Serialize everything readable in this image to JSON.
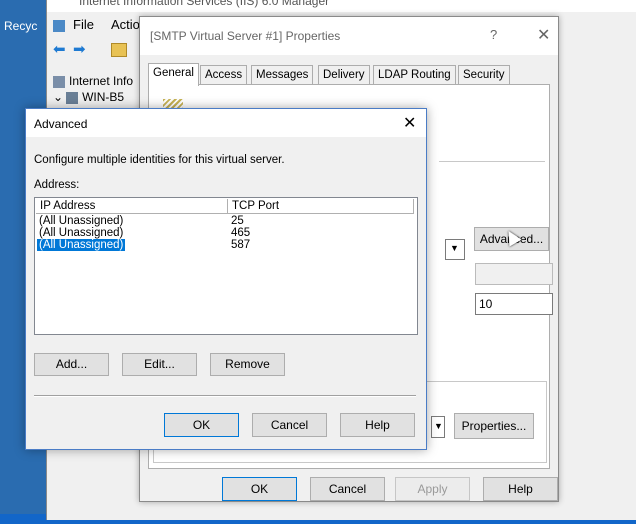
{
  "desktop": {
    "recycle_label": "Recyc"
  },
  "iis": {
    "title": "Internet Information Services (IIS) 6.0 Manager",
    "menu": {
      "file": "File",
      "action": "Actio"
    },
    "tree": {
      "root": "Internet Info",
      "server": "WIN-B5"
    }
  },
  "props": {
    "title": "[SMTP Virtual Server #1] Properties",
    "help_glyph": "?",
    "close_glyph": "✕",
    "tabs": [
      "General",
      "Access",
      "Messages",
      "Delivery",
      "LDAP Routing",
      "Security"
    ],
    "advanced_button": "Advanced...",
    "connections_value": "10",
    "properties_button": "Properties...",
    "buttons": {
      "ok": "OK",
      "cancel": "Cancel",
      "apply": "Apply",
      "help": "Help"
    }
  },
  "advanced": {
    "title": "Advanced",
    "close_glyph": "✕",
    "description": "Configure multiple identities for this virtual server.",
    "address_label": "Address:",
    "columns": {
      "ip": "IP Address",
      "port": "TCP Port"
    },
    "rows": [
      {
        "ip": "(All Unassigned)",
        "port": "25",
        "selected": false
      },
      {
        "ip": "(All Unassigned)",
        "port": "465",
        "selected": false
      },
      {
        "ip": "(All Unassigned)",
        "port": "587",
        "selected": true
      }
    ],
    "buttons": {
      "add": "Add...",
      "edit": "Edit...",
      "remove": "Remove",
      "ok": "OK",
      "cancel": "Cancel",
      "help": "Help"
    }
  }
}
